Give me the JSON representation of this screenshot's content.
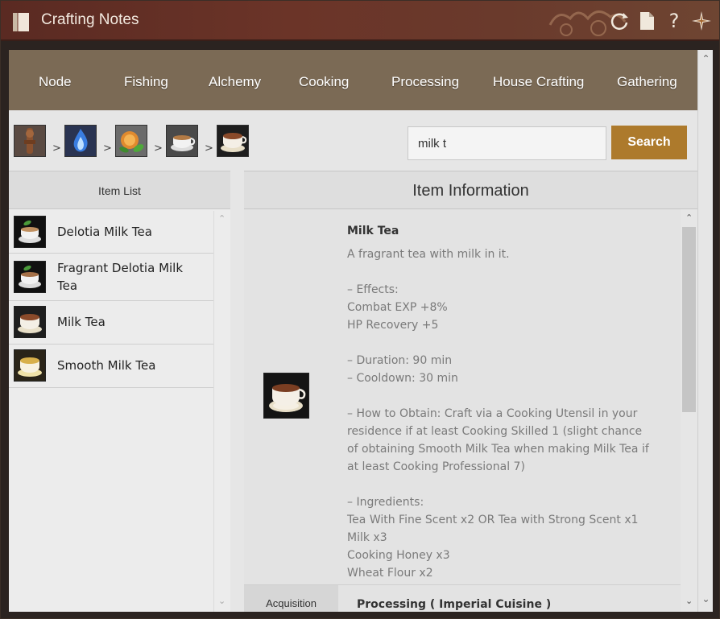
{
  "window": {
    "title": "Crafting Notes",
    "colors": {
      "titlebar": "#6b3428",
      "tabbar": "#7b6a55",
      "search_button": "#ad7a2c"
    },
    "tools": [
      "refresh-icon",
      "document-icon",
      "help-icon",
      "compass-icon"
    ],
    "help_glyph": "?"
  },
  "tabs": [
    "Node",
    "Fishing",
    "Alchemy",
    "Cooking",
    "Processing",
    "House Crafting",
    "Gathering"
  ],
  "breadcrumb": {
    "separator": ">",
    "icons": [
      "wooden-totem-icon",
      "blue-flame-icon",
      "tea-leaves-icon",
      "tea-cup-icon",
      "milk-tea-icon"
    ]
  },
  "search": {
    "value": "milk t",
    "button_label": "Search"
  },
  "item_list": {
    "header": "Item List",
    "items": [
      {
        "label": "Delotia Milk Tea",
        "icon": "delotia-milk-tea-icon"
      },
      {
        "label": "Fragrant Delotia Milk Tea",
        "icon": "fragrant-delotia-milk-tea-icon"
      },
      {
        "label": "Milk Tea",
        "icon": "milk-tea-icon"
      },
      {
        "label": "Smooth Milk Tea",
        "icon": "smooth-milk-tea-icon"
      }
    ]
  },
  "item_info": {
    "header": "Item Information",
    "name": "Milk Tea",
    "description": "A fragrant tea with milk in it.",
    "effects_header": "– Effects:",
    "effects": [
      "Combat EXP +8%",
      "HP Recovery +5"
    ],
    "duration": "– Duration: 90 min",
    "cooldown": "– Cooldown: 30 min",
    "how_to_obtain": "– How to Obtain: Craft via a Cooking Utensil in your residence if at least Cooking Skilled 1 (slight chance of obtaining Smooth Milk Tea when making Milk Tea if at least Cooking Professional 7)",
    "ingredients_header": "– Ingredients:",
    "ingredients": [
      "Tea With Fine Scent x2 OR Tea with Strong Scent x1",
      "Milk x3",
      "Cooking Honey x3",
      "Wheat Flour x2"
    ],
    "acquisition_label": "Acquisition",
    "acquisition_value": "Processing ( Imperial Cuisine )"
  }
}
